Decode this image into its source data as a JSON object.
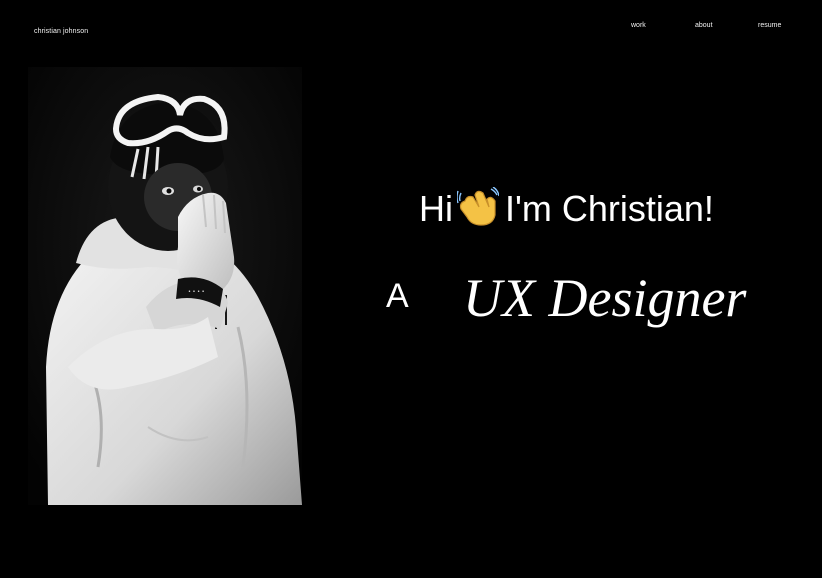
{
  "header": {
    "brand": "christian johnson",
    "nav": [
      {
        "label": "work"
      },
      {
        "label": "about"
      },
      {
        "label": "resume"
      }
    ]
  },
  "hero": {
    "greeting_before": "Hi",
    "greeting_icon": "waving-hand-icon",
    "greeting_after": "I'm Christian!",
    "article": "A",
    "role": "UX Designer"
  },
  "photo": {
    "subject": "portrait-photo",
    "style": "black-and-white"
  },
  "colors": {
    "background": "#000000",
    "text": "#ffffff",
    "wave_emoji": "#f4c245"
  }
}
